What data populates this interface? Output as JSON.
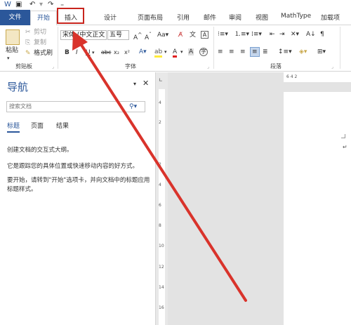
{
  "quick_access": {
    "save_icon": "save-icon",
    "undo_icon": "undo-icon",
    "redo_icon": "redo-icon"
  },
  "tabs": {
    "file": "文件",
    "home": "开始",
    "insert": "插入",
    "design": "设计",
    "layout": "页面布局",
    "references": "引用",
    "mailings": "邮件",
    "review": "审阅",
    "view": "视图",
    "mathtype": "MathType",
    "addins": "加载项"
  },
  "ribbon": {
    "clipboard": {
      "cut": "剪切",
      "copy": "复制",
      "format_painter": "格式刷",
      "paste": "粘贴",
      "group_label": "剪贴板"
    },
    "font": {
      "font_name": "宋体 (中文正文",
      "font_size": "五号",
      "group_label": "字体"
    },
    "paragraph": {
      "group_label": "段落"
    }
  },
  "nav_pane": {
    "title": "导航",
    "search_placeholder": "搜索文档",
    "tabs": [
      "标题",
      "页面",
      "结果"
    ],
    "hint1": "创建文档的交互式大纲。",
    "hint2": "它是跟踪您的具体位置或快速移动内容的好方式。",
    "hint3": "要开始，请转到\"开始\"选项卡，并向文档中的标题应用标题样式。"
  },
  "ruler": {
    "h_marks": "6  4  2",
    "v_marks": [
      "4",
      "2",
      "2",
      "4",
      "6",
      "8",
      "10",
      "12",
      "14",
      "16"
    ]
  },
  "colors": {
    "accent": "#2b579a",
    "highlight_box": "#c8251d",
    "arrow": "#d9332b"
  }
}
